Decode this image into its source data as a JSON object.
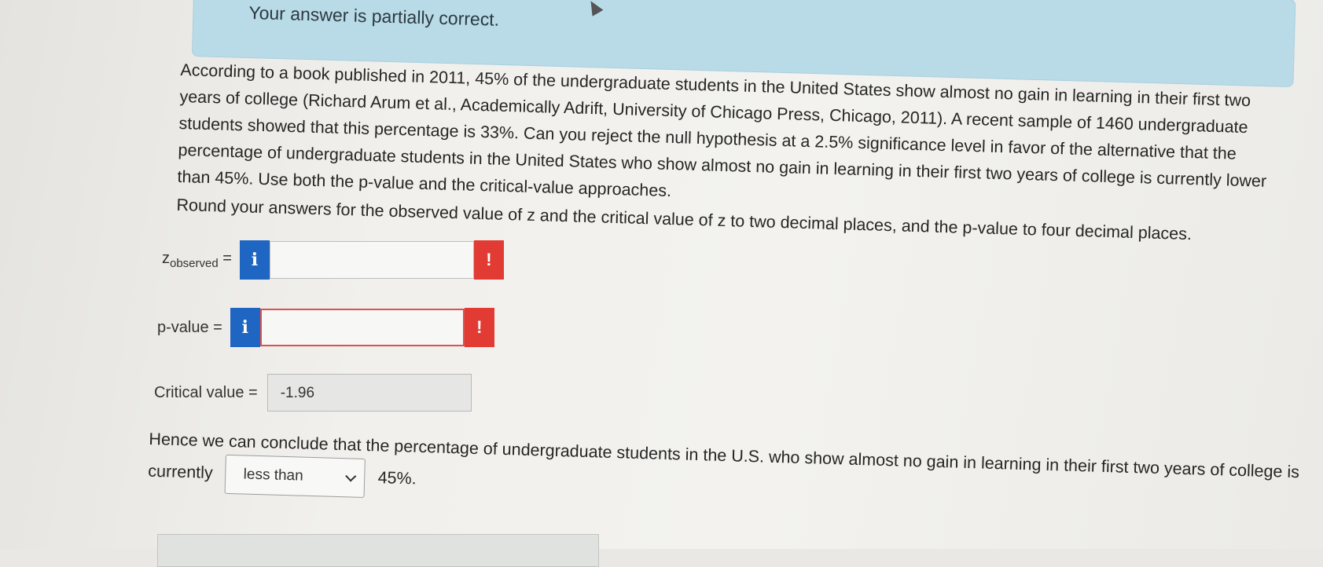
{
  "banner": {
    "text": "Your answer is partially correct."
  },
  "question": {
    "text": "According to a book published in 2011, 45% of the undergraduate students in the United States show almost no gain in learning in their first two years of college (Richard Arum et al., Academically Adrift, University of Chicago Press, Chicago, 2011). A recent sample of 1460 undergraduate students showed that this percentage is 33%. Can you reject the null hypothesis at a 2.5% significance level in favor of the alternative that the percentage of undergraduate students in the United States who show almost no gain in learning in their first two years of college is currently lower than 45%. Use both the p-value and the critical-value approaches.",
    "round_note": "Round your answers for the observed value of z and the critical value of z to two decimal places, and the p-value to four decimal places."
  },
  "fields": {
    "z_observed": {
      "label_main": "z",
      "label_sub": "observed",
      "equals": "=",
      "value": "",
      "info_icon": "i",
      "warn_icon": "!"
    },
    "p_value": {
      "label": "p-value =",
      "value": "",
      "info_icon": "i",
      "warn_icon": "!"
    },
    "critical_value": {
      "label": "Critical value =",
      "value": "-1.96"
    }
  },
  "conclusion": {
    "prefix": "Hence we can conclude that the percentage of undergraduate students in the U.S. who show almost no gain in learning in their first two years of college is currently",
    "selected": "less than",
    "suffix": "45%."
  },
  "colors": {
    "info_blue": "#1f66c2",
    "warn_red": "#e23b34",
    "banner_blue": "#b9dbe8"
  }
}
